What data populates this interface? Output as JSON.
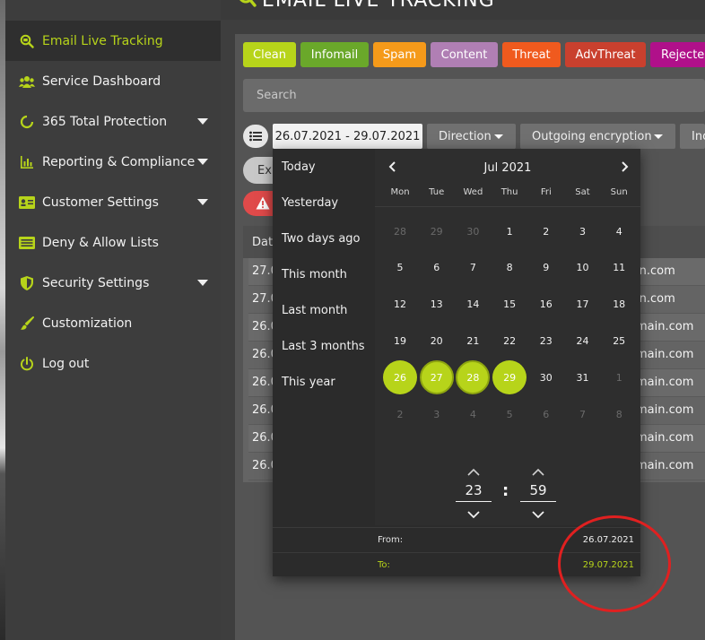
{
  "window": {
    "title": "EMAIL LIVE TRACKING"
  },
  "sidebar": {
    "items": [
      {
        "label": "Email Live Tracking",
        "icon": "search-envelope-icon",
        "active": true,
        "has_submenu": false
      },
      {
        "label": "Service Dashboard",
        "icon": "users-icon",
        "active": false,
        "has_submenu": false
      },
      {
        "label": "365 Total Protection",
        "icon": "refresh-ring-icon",
        "active": false,
        "has_submenu": true
      },
      {
        "label": "Reporting & Compliance",
        "icon": "bar-chart-icon",
        "active": false,
        "has_submenu": true
      },
      {
        "label": "Customer Settings",
        "icon": "id-card-icon",
        "active": false,
        "has_submenu": true
      },
      {
        "label": "Deny & Allow Lists",
        "icon": "list-icon",
        "active": false,
        "has_submenu": false
      },
      {
        "label": "Security Settings",
        "icon": "shield-icon",
        "active": false,
        "has_submenu": true
      },
      {
        "label": "Customization",
        "icon": "brush-icon",
        "active": false,
        "has_submenu": false
      },
      {
        "label": "Log out",
        "icon": "power-icon",
        "active": false,
        "has_submenu": false
      }
    ]
  },
  "filters": {
    "categories": [
      {
        "label": "Clean",
        "color": "#b7d41a"
      },
      {
        "label": "Infomail",
        "color": "#6aa82a"
      },
      {
        "label": "Spam",
        "color": "#f59a1a"
      },
      {
        "label": "Content",
        "color": "#b07fb4"
      },
      {
        "label": "Threat",
        "color": "#f05a1e"
      },
      {
        "label": "AdvThreat",
        "color": "#c9402e"
      },
      {
        "label": "Rejected",
        "color": "#b0108a"
      }
    ],
    "search_placeholder": "Search",
    "date_range": "26.07.2021 - 29.07.2021",
    "direction_label": "Direction",
    "encryption_label": "Outgoing encryption",
    "more_label": "Inc",
    "export_label": "Ex"
  },
  "table": {
    "date_header": "Dat",
    "rows": [
      {
        "date": "27.0",
        "domain": "in.com"
      },
      {
        "date": "27.0",
        "domain": "in.com"
      },
      {
        "date": "26.0",
        "domain": "main.com"
      },
      {
        "date": "26.0",
        "domain": "main.com"
      },
      {
        "date": "26.0",
        "domain": "main.com"
      },
      {
        "date": "26.0",
        "domain": "main.com"
      },
      {
        "date": "26.0",
        "domain": "main.com"
      },
      {
        "date": "26.0",
        "domain": "main.com"
      }
    ]
  },
  "datepicker": {
    "presets": [
      "Today",
      "Yesterday",
      "Two days ago",
      "This month",
      "Last month",
      "Last 3 months",
      "This year"
    ],
    "month": "Jul 2021",
    "weekdays": [
      "Mon",
      "Tue",
      "Wed",
      "Thu",
      "Fri",
      "Sat",
      "Sun"
    ],
    "weeks": [
      [
        {
          "d": "28",
          "o": true
        },
        {
          "d": "29",
          "o": true
        },
        {
          "d": "30",
          "o": true
        },
        {
          "d": "1"
        },
        {
          "d": "2"
        },
        {
          "d": "3"
        },
        {
          "d": "4"
        }
      ],
      [
        {
          "d": "5"
        },
        {
          "d": "6"
        },
        {
          "d": "7"
        },
        {
          "d": "8"
        },
        {
          "d": "9"
        },
        {
          "d": "10"
        },
        {
          "d": "11"
        }
      ],
      [
        {
          "d": "12"
        },
        {
          "d": "13"
        },
        {
          "d": "14"
        },
        {
          "d": "15"
        },
        {
          "d": "16"
        },
        {
          "d": "17"
        },
        {
          "d": "18"
        }
      ],
      [
        {
          "d": "19"
        },
        {
          "d": "20"
        },
        {
          "d": "21"
        },
        {
          "d": "22"
        },
        {
          "d": "23"
        },
        {
          "d": "24"
        },
        {
          "d": "25"
        }
      ],
      [
        {
          "d": "26",
          "s": "start"
        },
        {
          "d": "27",
          "s": "inner"
        },
        {
          "d": "28",
          "s": "inner"
        },
        {
          "d": "29",
          "s": "end"
        },
        {
          "d": "30"
        },
        {
          "d": "31"
        },
        {
          "d": "1",
          "o": true
        }
      ],
      [
        {
          "d": "2",
          "o": true
        },
        {
          "d": "3",
          "o": true
        },
        {
          "d": "4",
          "o": true
        },
        {
          "d": "5",
          "o": true
        },
        {
          "d": "6",
          "o": true
        },
        {
          "d": "7",
          "o": true
        },
        {
          "d": "8",
          "o": true
        }
      ]
    ],
    "hour": "23",
    "minute": "59",
    "time_separator": ":",
    "from_label": "From:",
    "from_value": "26.07.2021",
    "to_label": "To:",
    "to_value": "29.07.2021"
  },
  "colors": {
    "accent": "#b7d41a",
    "annotation": "#e02020"
  }
}
